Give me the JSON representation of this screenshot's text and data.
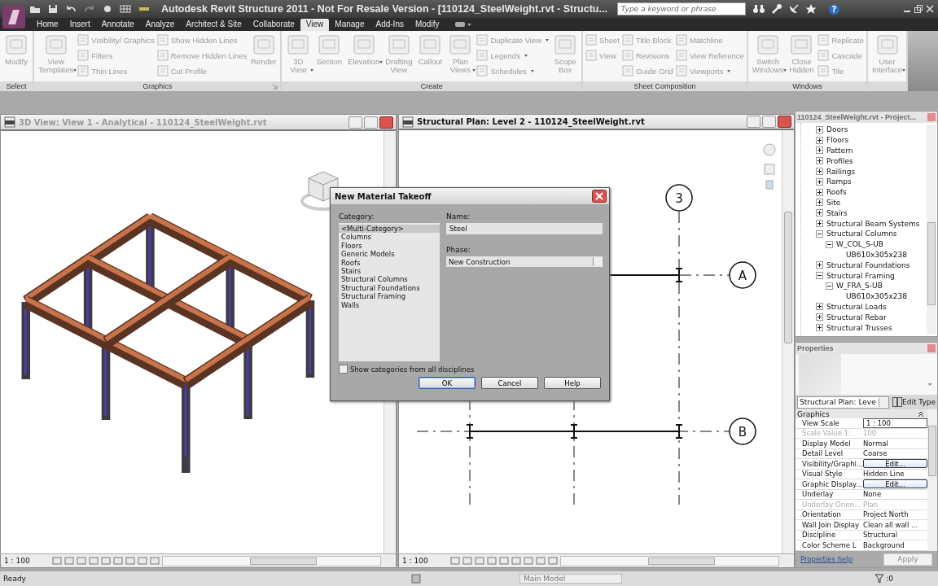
{
  "title_bar": {
    "title": "Autodesk Revit Structure 2011 - Not For Resale Version - [110124_SteelWeight.rvt - Structu...",
    "search": {
      "placeholder": "Type a keyword or phrase"
    },
    "help_glyph": "?"
  },
  "tabs": [
    {
      "label": "Home",
      "selected": false
    },
    {
      "label": "Insert",
      "selected": false
    },
    {
      "label": "Annotate",
      "selected": false
    },
    {
      "label": "Analyze",
      "selected": false
    },
    {
      "label": "Architect & Site",
      "selected": false
    },
    {
      "label": "Collaborate",
      "selected": false
    },
    {
      "label": "View",
      "selected": true
    },
    {
      "label": "Manage",
      "selected": false
    },
    {
      "label": "Add-Ins",
      "selected": false
    },
    {
      "label": "Modify",
      "selected": false
    }
  ],
  "ribbon": {
    "disabled": true,
    "panels": [
      {
        "label": "Select",
        "columns": [
          {
            "kind": "large",
            "label": "Modify",
            "dropdown": false
          }
        ]
      },
      {
        "label": "Graphics",
        "launcher": true,
        "columns": [
          {
            "kind": "large",
            "label": "View Templates",
            "dropdown": true
          },
          {
            "kind": "stack",
            "items": [
              {
                "label": "Visibility/ Graphics",
                "dropdown": false
              },
              {
                "label": "Filters",
                "dropdown": false
              },
              {
                "label": "Thin Lines",
                "dropdown": false
              }
            ]
          },
          {
            "kind": "stack",
            "items": [
              {
                "label": "Show Hidden Lines",
                "dropdown": false
              },
              {
                "label": "Remove Hidden Lines",
                "dropdown": false
              },
              {
                "label": "Cut Profile",
                "dropdown": false
              }
            ]
          },
          {
            "kind": "large",
            "label": "Render",
            "dropdown": false
          }
        ]
      },
      {
        "label": "Create",
        "columns": [
          {
            "kind": "large",
            "label": "3D View",
            "dropdown": true
          },
          {
            "kind": "large",
            "label": "Section",
            "dropdown": false
          },
          {
            "kind": "large",
            "label": "Elevation",
            "dropdown": true
          },
          {
            "kind": "large",
            "label": "Drafting View",
            "dropdown": false
          },
          {
            "kind": "large",
            "label": "Callout",
            "dropdown": false
          },
          {
            "kind": "large",
            "label": "Plan Views",
            "dropdown": true
          },
          {
            "kind": "stack",
            "items": [
              {
                "label": "Duplicate View",
                "dropdown": true
              },
              {
                "label": "Legends",
                "dropdown": true
              },
              {
                "label": "Schedules",
                "dropdown": true
              }
            ]
          },
          {
            "kind": "large",
            "label": "Scope Box",
            "dropdown": false
          }
        ]
      },
      {
        "label": "Sheet Composition",
        "columns": [
          {
            "kind": "stack",
            "items": [
              {
                "label": "Sheet",
                "dropdown": false
              },
              {
                "label": "View",
                "dropdown": false
              }
            ]
          },
          {
            "kind": "stack",
            "items": [
              {
                "label": "Title Block",
                "dropdown": false
              },
              {
                "label": "Revisions",
                "dropdown": false
              },
              {
                "label": "Guide Grid",
                "dropdown": false
              }
            ]
          },
          {
            "kind": "stack",
            "items": [
              {
                "label": "Matchline",
                "dropdown": false
              },
              {
                "label": "View Reference",
                "dropdown": false
              },
              {
                "label": "Viewports",
                "dropdown": true
              }
            ]
          }
        ]
      },
      {
        "label": "Windows",
        "columns": [
          {
            "kind": "large",
            "label": "Switch Windows",
            "dropdown": true
          },
          {
            "kind": "large",
            "label": "Close Hidden",
            "dropdown": false
          },
          {
            "kind": "stack",
            "items": [
              {
                "label": "Replicate",
                "dropdown": false
              },
              {
                "label": "Cascade",
                "dropdown": false
              },
              {
                "label": "Tile",
                "dropdown": false
              }
            ]
          }
        ]
      },
      {
        "columns": [
          {
            "kind": "large",
            "label": "User Interface",
            "dropdown": true
          }
        ]
      }
    ]
  },
  "views": [
    {
      "kind": "model",
      "title": "3D View: View 1 - Analytical - 110124_SteelWeight.rvt",
      "active": false,
      "scale": "1 : 100"
    },
    {
      "kind": "plan",
      "title": "Structural Plan: Level 2 - 110124_SteelWeight.rvt",
      "active": true,
      "scale": "1 : 100",
      "grids": [
        "3",
        "A",
        "B"
      ]
    }
  ],
  "project_browser": {
    "title": "110124_SteelWeight.rvt - Project...",
    "items": [
      {
        "label": "Doors",
        "expanded": false
      },
      {
        "label": "Floors",
        "expanded": false
      },
      {
        "label": "Pattern",
        "expanded": false
      },
      {
        "label": "Profiles",
        "expanded": false
      },
      {
        "label": "Railings",
        "expanded": false
      },
      {
        "label": "Ramps",
        "expanded": false
      },
      {
        "label": "Roofs",
        "expanded": false
      },
      {
        "label": "Site",
        "expanded": false
      },
      {
        "label": "Stairs",
        "expanded": false
      },
      {
        "label": "Structural Beam Systems",
        "expanded": false
      },
      {
        "label": "Structural Columns",
        "expanded": true,
        "children": [
          {
            "label": "W_COL_S-UB",
            "expanded": true,
            "children": [
              {
                "label": "UB610x305x238"
              }
            ]
          }
        ]
      },
      {
        "label": "Structural Foundations",
        "expanded": false
      },
      {
        "label": "Structural Framing",
        "expanded": true,
        "children": [
          {
            "label": "W_FRA_S-UB",
            "expanded": true,
            "children": [
              {
                "label": "UB610x305x238"
              }
            ]
          }
        ]
      },
      {
        "label": "Structural Loads",
        "expanded": false
      },
      {
        "label": "Structural Rebar",
        "expanded": false
      },
      {
        "label": "Structural Trusses",
        "expanded": false
      }
    ]
  },
  "properties": {
    "title": "Properties",
    "type_selector": "Structural Plan: Leve",
    "edit_type": "Edit Type",
    "group": "Graphics",
    "rows": [
      {
        "name": "View Scale",
        "value": "1 : 100",
        "kind": "field",
        "disabled": false
      },
      {
        "name": "Scale Value    1:",
        "value": "100",
        "kind": "text",
        "disabled": true
      },
      {
        "name": "Display Model",
        "value": "Normal",
        "kind": "text",
        "disabled": false
      },
      {
        "name": "Detail Level",
        "value": "Coarse",
        "kind": "text",
        "disabled": false
      },
      {
        "name": "Visibility/Graphi...",
        "value": "Edit...",
        "kind": "button",
        "disabled": false
      },
      {
        "name": "Visual Style",
        "value": "Hidden Line",
        "kind": "text",
        "disabled": false
      },
      {
        "name": "Graphic Display...",
        "value": "Edit...",
        "kind": "button",
        "disabled": false
      },
      {
        "name": "Underlay",
        "value": "None",
        "kind": "text",
        "disabled": false
      },
      {
        "name": "Underlay Orien...",
        "value": "Plan",
        "kind": "text",
        "disabled": true
      },
      {
        "name": "Orientation",
        "value": "Project North",
        "kind": "text",
        "disabled": false
      },
      {
        "name": "Wall Join Display",
        "value": "Clean all wall ...",
        "kind": "text",
        "disabled": false
      },
      {
        "name": "Discipline",
        "value": "Structural",
        "kind": "text",
        "disabled": false
      },
      {
        "name": "Color Scheme L",
        "value": "Background",
        "kind": "text",
        "disabled": false
      }
    ],
    "help_link": "Properties help",
    "apply": {
      "label": "Apply",
      "disabled": true
    }
  },
  "dialog": {
    "title": "New Material Takeoff",
    "category_label": "Category:",
    "categories": [
      {
        "label": "<Multi-Category>",
        "selected": true
      },
      {
        "label": "Columns",
        "selected": false
      },
      {
        "label": "Floors",
        "selected": false
      },
      {
        "label": "Generic Models",
        "selected": false
      },
      {
        "label": "Roofs",
        "selected": false
      },
      {
        "label": "Stairs",
        "selected": false
      },
      {
        "label": "Structural Columns",
        "selected": false
      },
      {
        "label": "Structural Foundations",
        "selected": false
      },
      {
        "label": "Structural Framing",
        "selected": false
      },
      {
        "label": "Walls",
        "selected": false
      }
    ],
    "name_label": "Name:",
    "name_value": "Steel",
    "phase_label": "Phase:",
    "phase_value": "New Construction",
    "show_all": {
      "label": "Show categories from all disciplines",
      "checked": false
    },
    "buttons": [
      {
        "label": "OK",
        "default": true
      },
      {
        "label": "Cancel",
        "default": false
      },
      {
        "label": "Help",
        "default": false
      }
    ]
  },
  "status_bar": {
    "text": "Ready",
    "model": "Main Model",
    "filter_count": ":0"
  }
}
